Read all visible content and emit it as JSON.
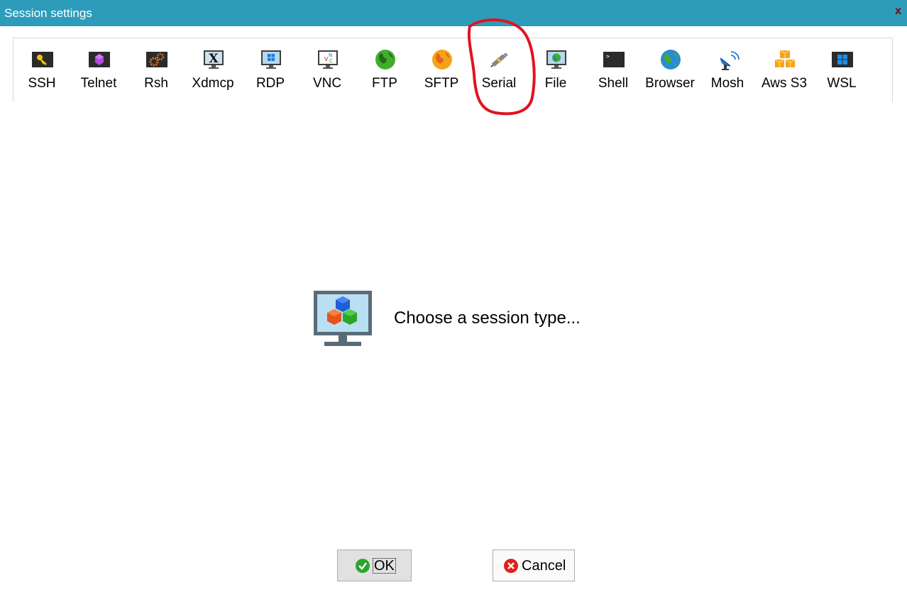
{
  "window": {
    "title": "Session settings",
    "close_label": "x"
  },
  "toolbar": {
    "items": [
      {
        "label": "SSH",
        "icon": "key-icon"
      },
      {
        "label": "Telnet",
        "icon": "telnet-icon"
      },
      {
        "label": "Rsh",
        "icon": "rsh-gears-icon"
      },
      {
        "label": "Xdmcp",
        "icon": "xdmcp-x-icon"
      },
      {
        "label": "RDP",
        "icon": "rdp-windows-monitor-icon"
      },
      {
        "label": "VNC",
        "icon": "vnc-monitor-icon"
      },
      {
        "label": "FTP",
        "icon": "ftp-globe-icon"
      },
      {
        "label": "SFTP",
        "icon": "sftp-globe-icon"
      },
      {
        "label": "Serial",
        "icon": "serial-plug-icon"
      },
      {
        "label": "File",
        "icon": "file-monitor-icon"
      },
      {
        "label": "Shell",
        "icon": "shell-terminal-icon"
      },
      {
        "label": "Browser",
        "icon": "browser-globe-icon"
      },
      {
        "label": "Mosh",
        "icon": "mosh-satellite-icon"
      },
      {
        "label": "Aws S3",
        "icon": "aws-s3-boxes-icon"
      },
      {
        "label": "WSL",
        "icon": "wsl-windows-icon"
      }
    ]
  },
  "main": {
    "prompt": "Choose a session type...",
    "icon": "session-monitor-cubes-icon"
  },
  "buttons": {
    "ok_label": "OK",
    "cancel_label": "Cancel"
  },
  "colors": {
    "titlebar": "#2d9cbb",
    "annotation": "#e0141e"
  }
}
